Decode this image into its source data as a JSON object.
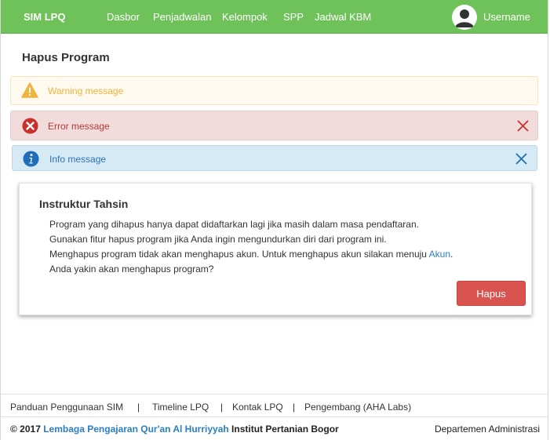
{
  "navbar": {
    "brand": "SIM LPQ",
    "items": [
      "Dasbor",
      "Penjadwalan",
      "Kelompok",
      "SPP",
      "Jadwal KBM"
    ],
    "username": "Username"
  },
  "page": {
    "title": "Hapus Program"
  },
  "alerts": {
    "warning": "Warning message",
    "error": "Error message",
    "info": "Info message"
  },
  "card": {
    "title": "Instruktur Tahsin",
    "line1": "Program yang dihapus hanya dapat didaftarkan lagi jika masih dalam masa pendaftaran.",
    "line2": "Gunakan fitur hapus program jika Anda ingin mengundurkan diri dari program ini.",
    "line3_prefix": "Menghapus program tidak akan menghapus akun. Untuk menghapus akun silakan menuju ",
    "line3_link": "Akun",
    "line3_suffix": ".",
    "line4": "Anda yakin akan menghapus program?",
    "button": "Hapus"
  },
  "footer": {
    "links": [
      "Panduan Penggunaan SIM",
      "Timeline LPQ",
      "Kontak LPQ",
      "Pengembang (AHA Labs)"
    ],
    "separator": "|",
    "copyright_prefix": "© 2017 ",
    "copyright_link": "Lembaga Pengajaran Qur'an Al Hurriyyah",
    "copyright_suffix": " Institut Pertanian Bogor",
    "department": "Departemen Administrasi"
  },
  "colors": {
    "navbar": "#6fc25a",
    "warning": "#f0b33c",
    "error": "#b43a3a",
    "info": "#2d74b5",
    "button": "#d9534f"
  }
}
